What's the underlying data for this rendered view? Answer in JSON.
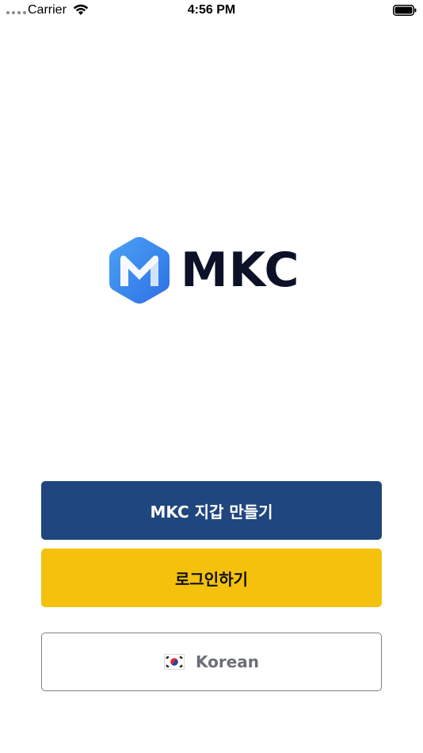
{
  "status_bar": {
    "carrier": "Carrier",
    "time": "4:56 PM"
  },
  "logo": {
    "wordmark": "MKC",
    "icon": "mkc-hexagon-logo-icon",
    "wordmark_color": "#0c1128",
    "icon_color": "#3b8cf0"
  },
  "buttons": {
    "create_wallet": "MKC 지갑 만들기",
    "login": "로그인하기",
    "language": "Korean"
  },
  "colors": {
    "create_wallet_bg": "#1f467d",
    "login_bg": "#f4c20d"
  },
  "icons": {
    "language_flag": "korea-flag-icon"
  }
}
